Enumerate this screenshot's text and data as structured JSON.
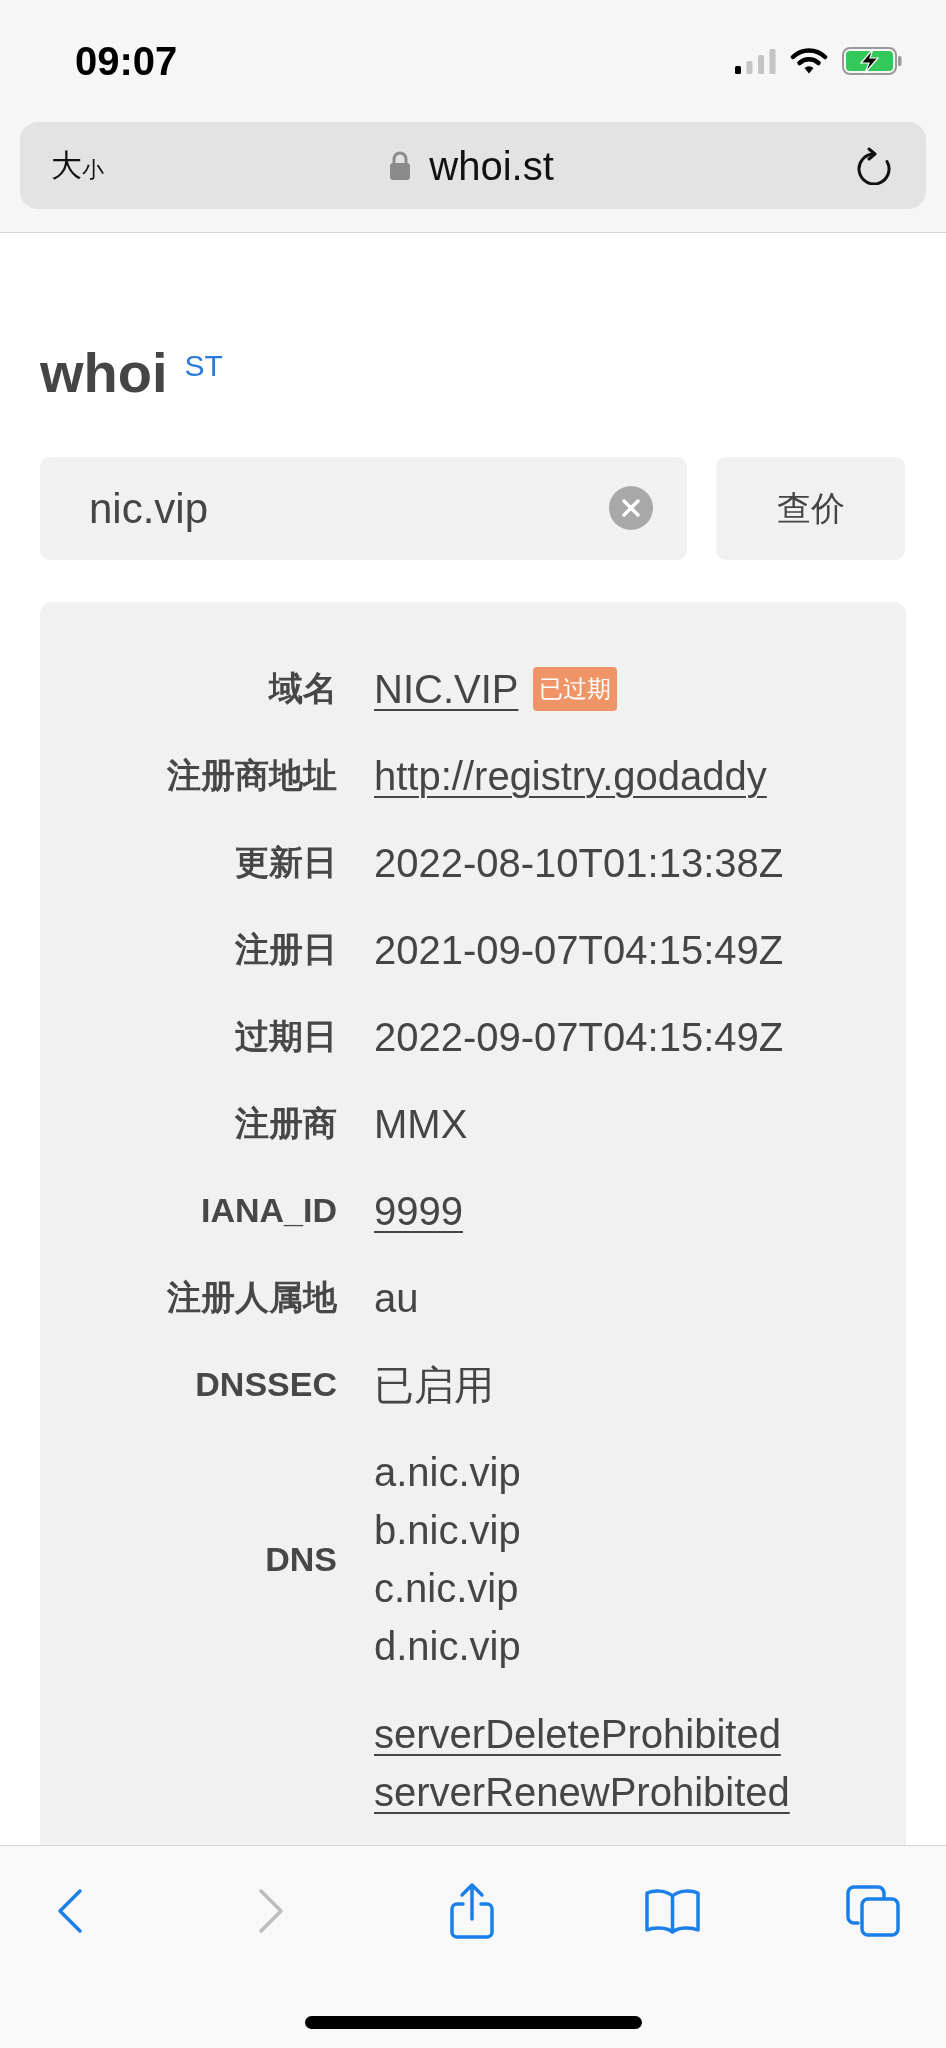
{
  "status_bar": {
    "time": "09:07"
  },
  "address_bar": {
    "text_size_button": {
      "large": "大",
      "small": "小"
    },
    "secure": true,
    "url": "whoi.st"
  },
  "logo": {
    "name": "whoi",
    "suffix": "ST"
  },
  "search": {
    "value": "nic.vip",
    "button": "查价"
  },
  "result_rows": [
    {
      "label": "域名",
      "values": [
        "NIC.VIP"
      ],
      "link": true,
      "badge": "已过期"
    },
    {
      "label": "注册商地址",
      "values": [
        "http://registry.godaddy"
      ],
      "link": true
    },
    {
      "label": "更新日",
      "values": [
        "2022-08-10T01:13:38Z"
      ],
      "link": false
    },
    {
      "label": "注册日",
      "values": [
        "2021-09-07T04:15:49Z"
      ],
      "link": false
    },
    {
      "label": "过期日",
      "values": [
        "2022-09-07T04:15:49Z"
      ],
      "link": false
    },
    {
      "label": "注册商",
      "values": [
        "MMX"
      ],
      "link": false
    },
    {
      "label": "IANA_ID",
      "values": [
        "9999"
      ],
      "link": true
    },
    {
      "label": "注册人属地",
      "values": [
        "au"
      ],
      "link": false
    },
    {
      "label": "DNSSEC",
      "values": [
        "已启用"
      ],
      "link": false
    },
    {
      "label": "DNS",
      "values": [
        "a.nic.vip",
        "b.nic.vip",
        "c.nic.vip",
        "d.nic.vip"
      ],
      "link": false
    },
    {
      "values": [
        "serverDeleteProhibited",
        "serverRenewProhibited"
      ],
      "link": true
    }
  ],
  "toolbar": [
    {
      "kind": "back",
      "disabled": false
    },
    {
      "kind": "forward",
      "disabled": true
    },
    {
      "kind": "share",
      "disabled": false
    },
    {
      "kind": "bookmarks",
      "disabled": false
    },
    {
      "kind": "tabs",
      "disabled": false
    }
  ]
}
